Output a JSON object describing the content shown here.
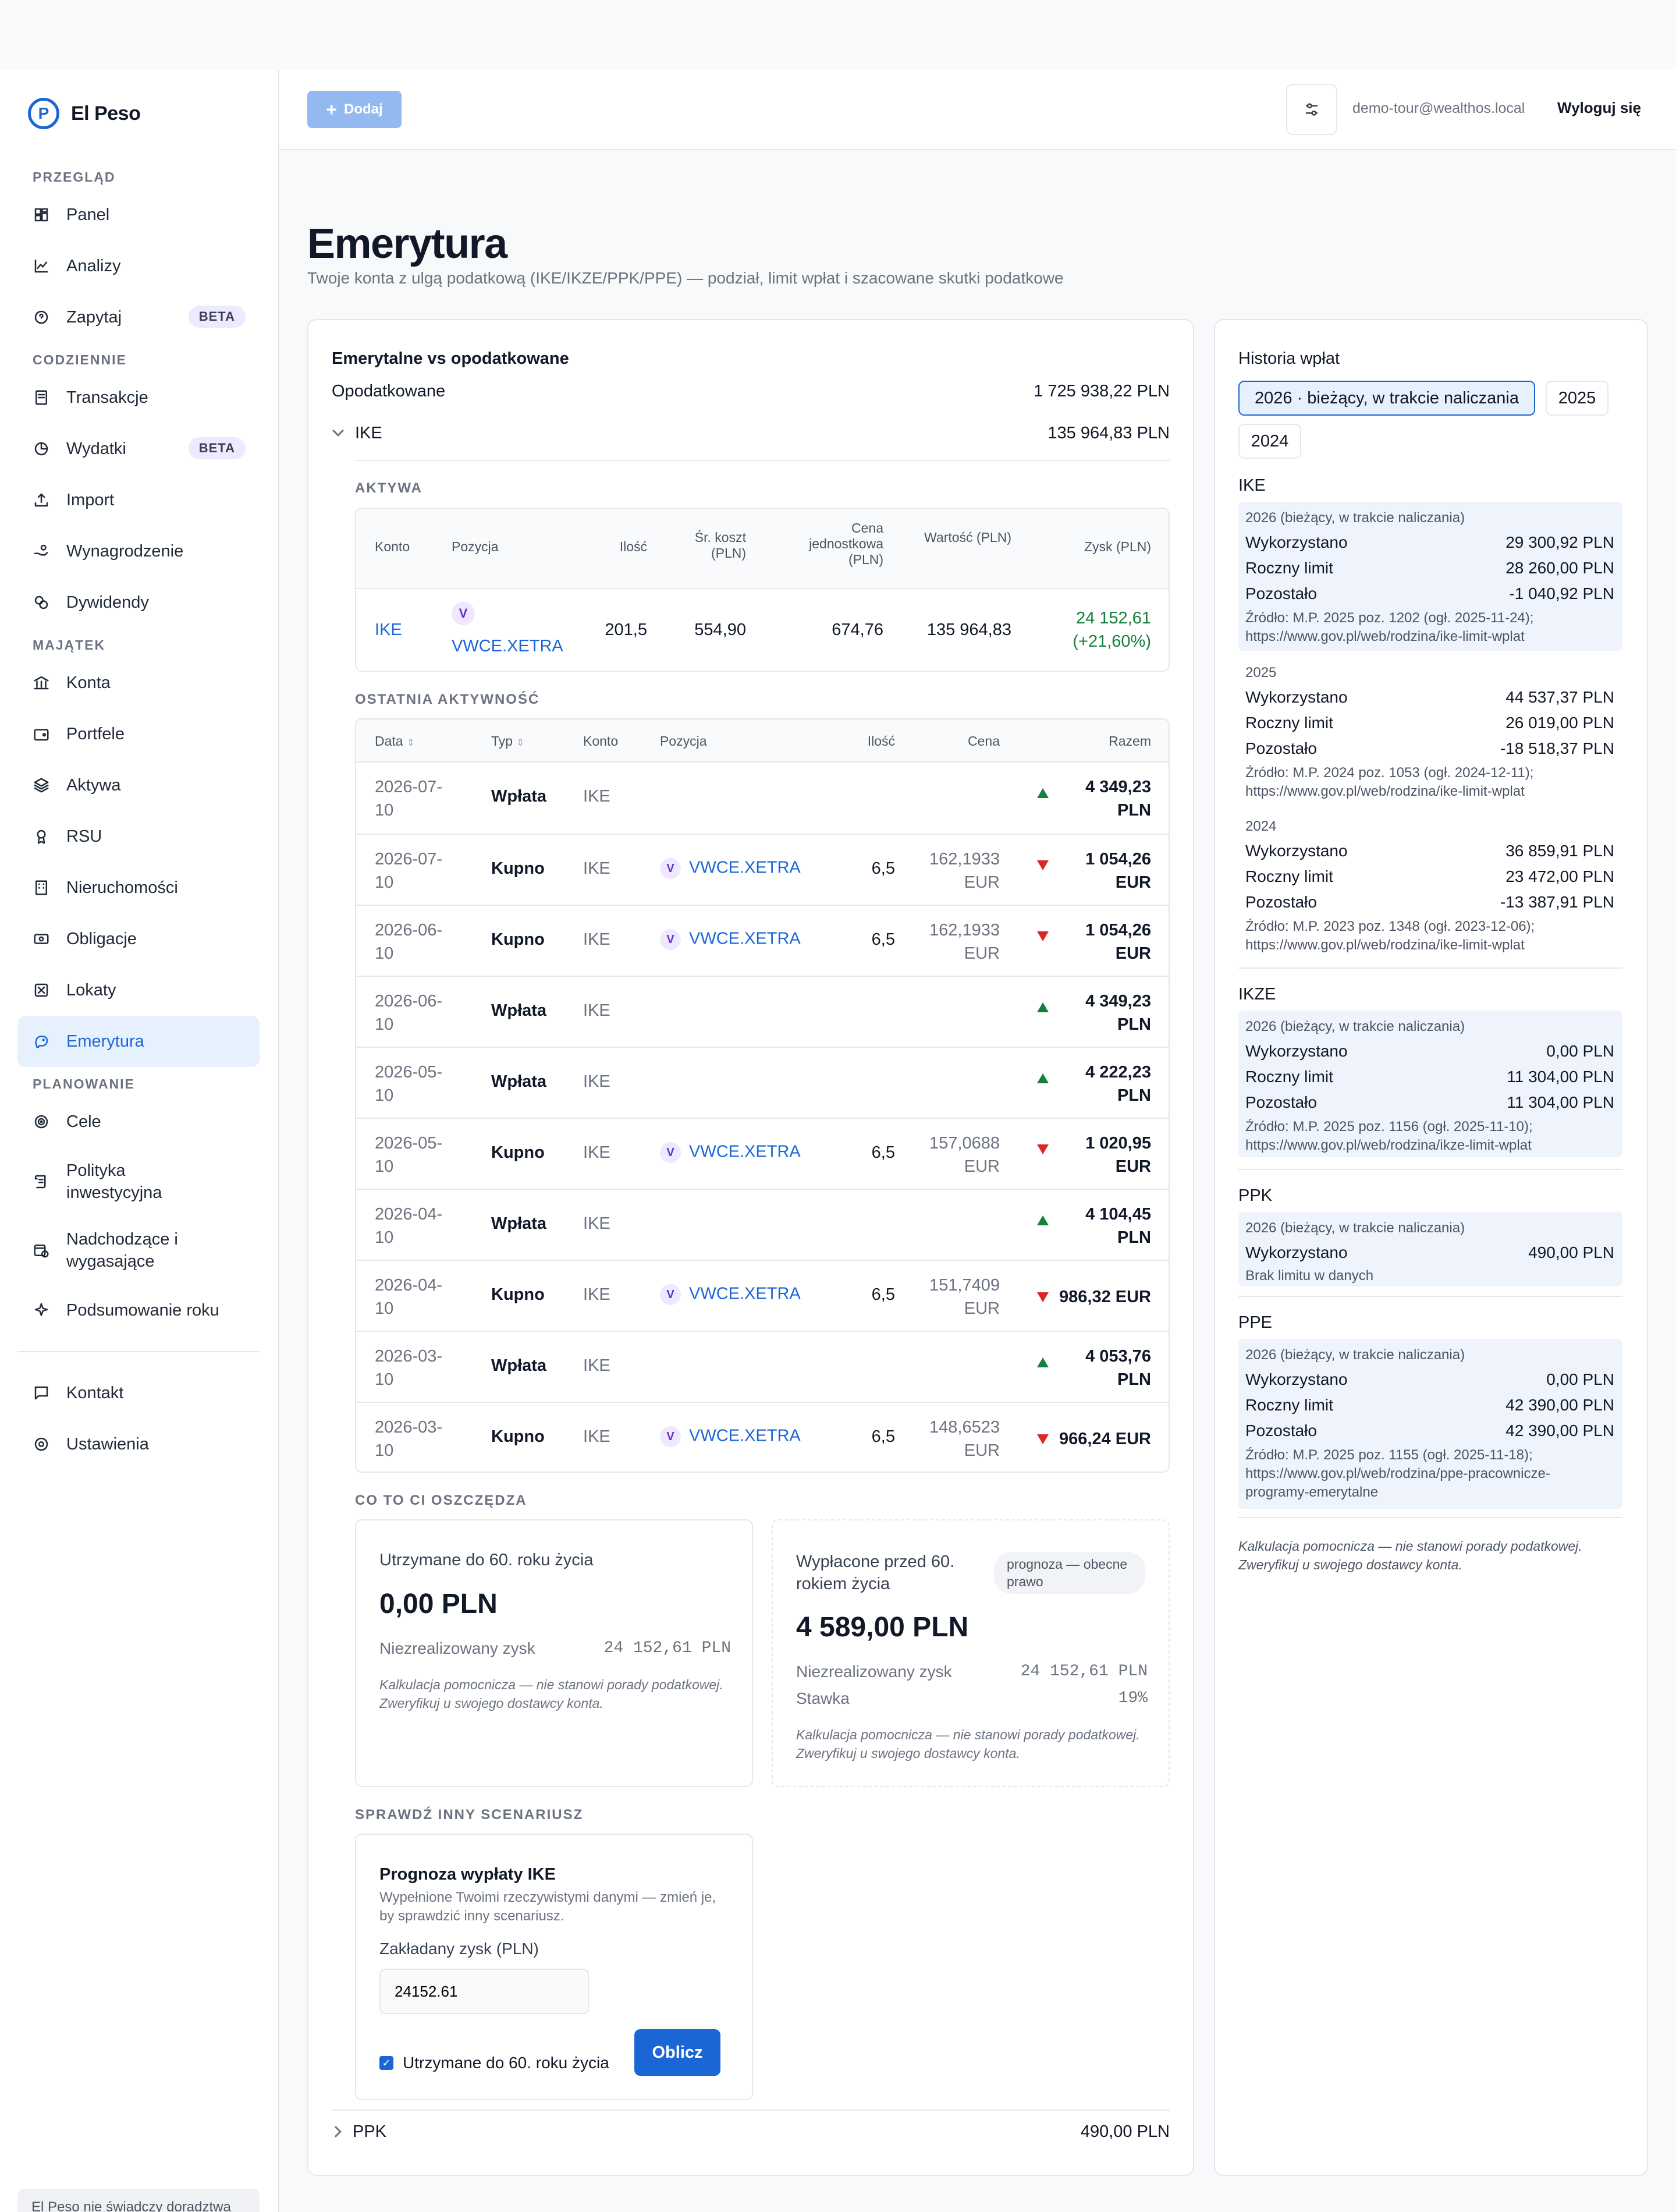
{
  "app": {
    "name": "El Peso",
    "disclaimer": "El Peso nie świadczy doradztwa"
  },
  "sidebar": {
    "sections": [
      {
        "label": "PRZEGLĄD",
        "items": [
          {
            "label": "Panel",
            "icon": "dashboard-icon"
          },
          {
            "label": "Analizy",
            "icon": "chart-line-icon"
          },
          {
            "label": "Zapytaj",
            "icon": "chat-question-icon",
            "badge": "BETA"
          }
        ]
      },
      {
        "label": "CODZIENNIE",
        "items": [
          {
            "label": "Transakcje",
            "icon": "receipt-icon"
          },
          {
            "label": "Wydatki",
            "icon": "pie-chart-icon",
            "badge": "BETA"
          },
          {
            "label": "Import",
            "icon": "upload-icon"
          },
          {
            "label": "Wynagrodzenie",
            "icon": "hand-coins-icon"
          },
          {
            "label": "Dywidendy",
            "icon": "coins-icon"
          }
        ]
      },
      {
        "label": "MAJĄTEK",
        "items": [
          {
            "label": "Konta",
            "icon": "bank-icon"
          },
          {
            "label": "Portfele",
            "icon": "wallet-icon"
          },
          {
            "label": "Aktywa",
            "icon": "layers-icon"
          },
          {
            "label": "RSU",
            "icon": "award-icon"
          },
          {
            "label": "Nieruchomości",
            "icon": "building-icon"
          },
          {
            "label": "Obligacje",
            "icon": "banknote-icon"
          },
          {
            "label": "Lokaty",
            "icon": "vault-icon"
          },
          {
            "label": "Emerytura",
            "icon": "piggy-bank-icon",
            "active": true
          }
        ]
      },
      {
        "label": "PLANOWANIE",
        "items": [
          {
            "label": "Cele",
            "icon": "target-icon"
          },
          {
            "label": "Polityka inwestycyjna",
            "icon": "scroll-icon"
          },
          {
            "label": "Nadchodzące i wygasające",
            "icon": "calendar-clock-icon"
          },
          {
            "label": "Podsumowanie roku",
            "icon": "sparkles-icon"
          }
        ]
      }
    ],
    "footer_items": [
      {
        "label": "Kontakt",
        "icon": "message-square-icon"
      },
      {
        "label": "Ustawienia",
        "icon": "settings-icon"
      }
    ]
  },
  "header": {
    "add_label": "Dodaj",
    "user_email": "demo-tour@wealthos.local",
    "logout_label": "Wyloguj się"
  },
  "page": {
    "title": "Emerytura",
    "subtitle": "Twoje konta z ulgą podatkową (IKE/IKZE/PPK/PPE) — podział, limit wpłat i szacowane skutki podatkowe"
  },
  "main": {
    "heading": "Emerytalne vs opodatkowane",
    "taxed_label": "Opodatkowane",
    "taxed_value": "1 725 938,22 PLN",
    "ike_label": "IKE",
    "ike_value": "135 964,83 PLN",
    "assets_label": "AKTYWA",
    "assets_headers": [
      "Konto",
      "Pozycja",
      "Ilość",
      "Śr. koszt (PLN)",
      "Cena jednostkowa (PLN)",
      "Wartość (PLN)",
      "Zysk (PLN)"
    ],
    "asset_row": {
      "account": "IKE",
      "badge": "V",
      "position": "VWCE.XETRA",
      "qty": "201,5",
      "avg_cost": "554,90",
      "unit_price": "674,76",
      "value": "135 964,83",
      "profit": "24 152,61",
      "profit_pct": "(+21,60%)"
    },
    "activity_label": "OSTATNIA AKTYWNOŚĆ",
    "activity_headers": [
      "Data",
      "Typ",
      "Konto",
      "Pozycja",
      "Ilość",
      "Cena",
      "Razem"
    ],
    "activity": [
      {
        "date1": "2026-07-",
        "date2": "10",
        "type": "Wpłata",
        "account": "IKE",
        "position": "",
        "qty": "",
        "price1": "",
        "price2": "",
        "dir": "up",
        "total1": "4 349,23",
        "total2": "PLN"
      },
      {
        "date1": "2026-07-",
        "date2": "10",
        "type": "Kupno",
        "account": "IKE",
        "position": "VWCE.XETRA",
        "qty": "6,5",
        "price1": "162,1933",
        "price2": "EUR",
        "dir": "down",
        "total1": "1 054,26",
        "total2": "EUR"
      },
      {
        "date1": "2026-06-",
        "date2": "10",
        "type": "Kupno",
        "account": "IKE",
        "position": "VWCE.XETRA",
        "qty": "6,5",
        "price1": "162,1933",
        "price2": "EUR",
        "dir": "down",
        "total1": "1 054,26",
        "total2": "EUR"
      },
      {
        "date1": "2026-06-",
        "date2": "10",
        "type": "Wpłata",
        "account": "IKE",
        "position": "",
        "qty": "",
        "price1": "",
        "price2": "",
        "dir": "up",
        "total1": "4 349,23",
        "total2": "PLN"
      },
      {
        "date1": "2026-05-",
        "date2": "10",
        "type": "Wpłata",
        "account": "IKE",
        "position": "",
        "qty": "",
        "price1": "",
        "price2": "",
        "dir": "up",
        "total1": "4 222,23",
        "total2": "PLN"
      },
      {
        "date1": "2026-05-",
        "date2": "10",
        "type": "Kupno",
        "account": "IKE",
        "position": "VWCE.XETRA",
        "qty": "6,5",
        "price1": "157,0688",
        "price2": "EUR",
        "dir": "down",
        "total1": "1 020,95",
        "total2": "EUR"
      },
      {
        "date1": "2026-04-",
        "date2": "10",
        "type": "Wpłata",
        "account": "IKE",
        "position": "",
        "qty": "",
        "price1": "",
        "price2": "",
        "dir": "up",
        "total1": "4 104,45",
        "total2": "PLN"
      },
      {
        "date1": "2026-04-",
        "date2": "10",
        "type": "Kupno",
        "account": "IKE",
        "position": "VWCE.XETRA",
        "qty": "6,5",
        "price1": "151,7409",
        "price2": "EUR",
        "dir": "down",
        "total1": "986,32 EUR",
        "total2": ""
      },
      {
        "date1": "2026-03-",
        "date2": "10",
        "type": "Wpłata",
        "account": "IKE",
        "position": "",
        "qty": "",
        "price1": "",
        "price2": "",
        "dir": "up",
        "total1": "4 053,76",
        "total2": "PLN"
      },
      {
        "date1": "2026-03-",
        "date2": "10",
        "type": "Kupno",
        "account": "IKE",
        "position": "VWCE.XETRA",
        "qty": "6,5",
        "price1": "148,6523",
        "price2": "EUR",
        "dir": "down",
        "total1": "966,24 EUR",
        "total2": ""
      }
    ],
    "savings_label": "CO TO CI OSZCZĘDZA",
    "keep": {
      "title": "Utrzymane do 60. roku życia",
      "amount": "0,00 PLN",
      "unrealized_label": "Niezrealizowany zysk",
      "unrealized_value": "24 152,61 PLN",
      "note": "Kalkulacja pomocnicza — nie stanowi porady podatkowej. Zweryfikuj u swojego dostawcy konta."
    },
    "withdraw": {
      "title": "Wypłacone przed 60. rokiem życia",
      "badge": "prognoza — obecne prawo",
      "amount": "4 589,00 PLN",
      "unrealized_label": "Niezrealizowany zysk",
      "unrealized_value": "24 152,61 PLN",
      "rate_label": "Stawka",
      "rate_value": "19%",
      "note": "Kalkulacja pomocnicza — nie stanowi porady podatkowej. Zweryfikuj u swojego dostawcy konta."
    },
    "scenario_label": "SPRAWDŹ INNY SCENARIUSZ",
    "scenario": {
      "title": "Prognoza wypłaty IKE",
      "desc": "Wypełnione Twoimi rzeczywistymi danymi — zmień je, by sprawdzić inny scenariusz.",
      "field_label": "Zakładany zysk (PLN)",
      "field_value": "24152.61",
      "checkbox_label": "Utrzymane do 60. roku życia",
      "checkbox_checked": true,
      "submit": "Oblicz"
    },
    "ppk_label": "PPK",
    "ppk_value": "490,00 PLN"
  },
  "history": {
    "title": "Historia wpłat",
    "tabs": [
      "2026 · bieżący, w trakcie naliczania",
      "2025",
      "2024"
    ],
    "ike": {
      "label": "IKE",
      "years": [
        {
          "year": "2026 (bieżący, w trakcie naliczania)",
          "used": "29 300,92 PLN",
          "limit": "28 260,00 PLN",
          "left": "-1 040,92 PLN",
          "src1": "Źródło: M.P. 2025 poz. 1202 (ogł. 2025-11-24);",
          "src2": "https://www.gov.pl/web/rodzina/ike-limit-wplat"
        },
        {
          "year": "2025",
          "used": "44 537,37 PLN",
          "limit": "26 019,00 PLN",
          "left": "-18 518,37 PLN",
          "src1": "Źródło: M.P. 2024 poz. 1053 (ogł. 2024-12-11);",
          "src2": "https://www.gov.pl/web/rodzina/ike-limit-wplat"
        },
        {
          "year": "2024",
          "used": "36 859,91 PLN",
          "limit": "23 472,00 PLN",
          "left": "-13 387,91 PLN",
          "src1": "Źródło: M.P. 2023 poz. 1348 (ogł. 2023-12-06);",
          "src2": "https://www.gov.pl/web/rodzina/ike-limit-wplat"
        }
      ]
    },
    "ikze": {
      "label": "IKZE",
      "year": "2026 (bieżący, w trakcie naliczania)",
      "used": "0,00 PLN",
      "limit": "11 304,00 PLN",
      "left": "11 304,00 PLN",
      "src1": "Źródło: M.P. 2025 poz. 1156 (ogł. 2025-11-10);",
      "src2": "https://www.gov.pl/web/rodzina/ikze-limit-wplat"
    },
    "ppk": {
      "label": "PPK",
      "year": "2026 (bieżący, w trakcie naliczania)",
      "used": "490,00 PLN",
      "note": "Brak limitu w danych"
    },
    "ppe": {
      "label": "PPE",
      "year": "2026 (bieżący, w trakcie naliczania)",
      "used": "0,00 PLN",
      "limit": "42 390,00 PLN",
      "left": "42 390,00 PLN",
      "src1": "Źródło: M.P. 2025 poz. 1155 (ogł. 2025-11-18);",
      "src2": "https://www.gov.pl/web/rodzina/ppe-pracownicze-",
      "src3": "programy-emerytalne"
    },
    "labels": {
      "used": "Wykorzystano",
      "limit": "Roczny limit",
      "left": "Pozostało"
    },
    "footnote": "Kalkulacja pomocnicza — nie stanowi porady podatkowej. Zweryfikuj u swojego dostawcy konta."
  }
}
